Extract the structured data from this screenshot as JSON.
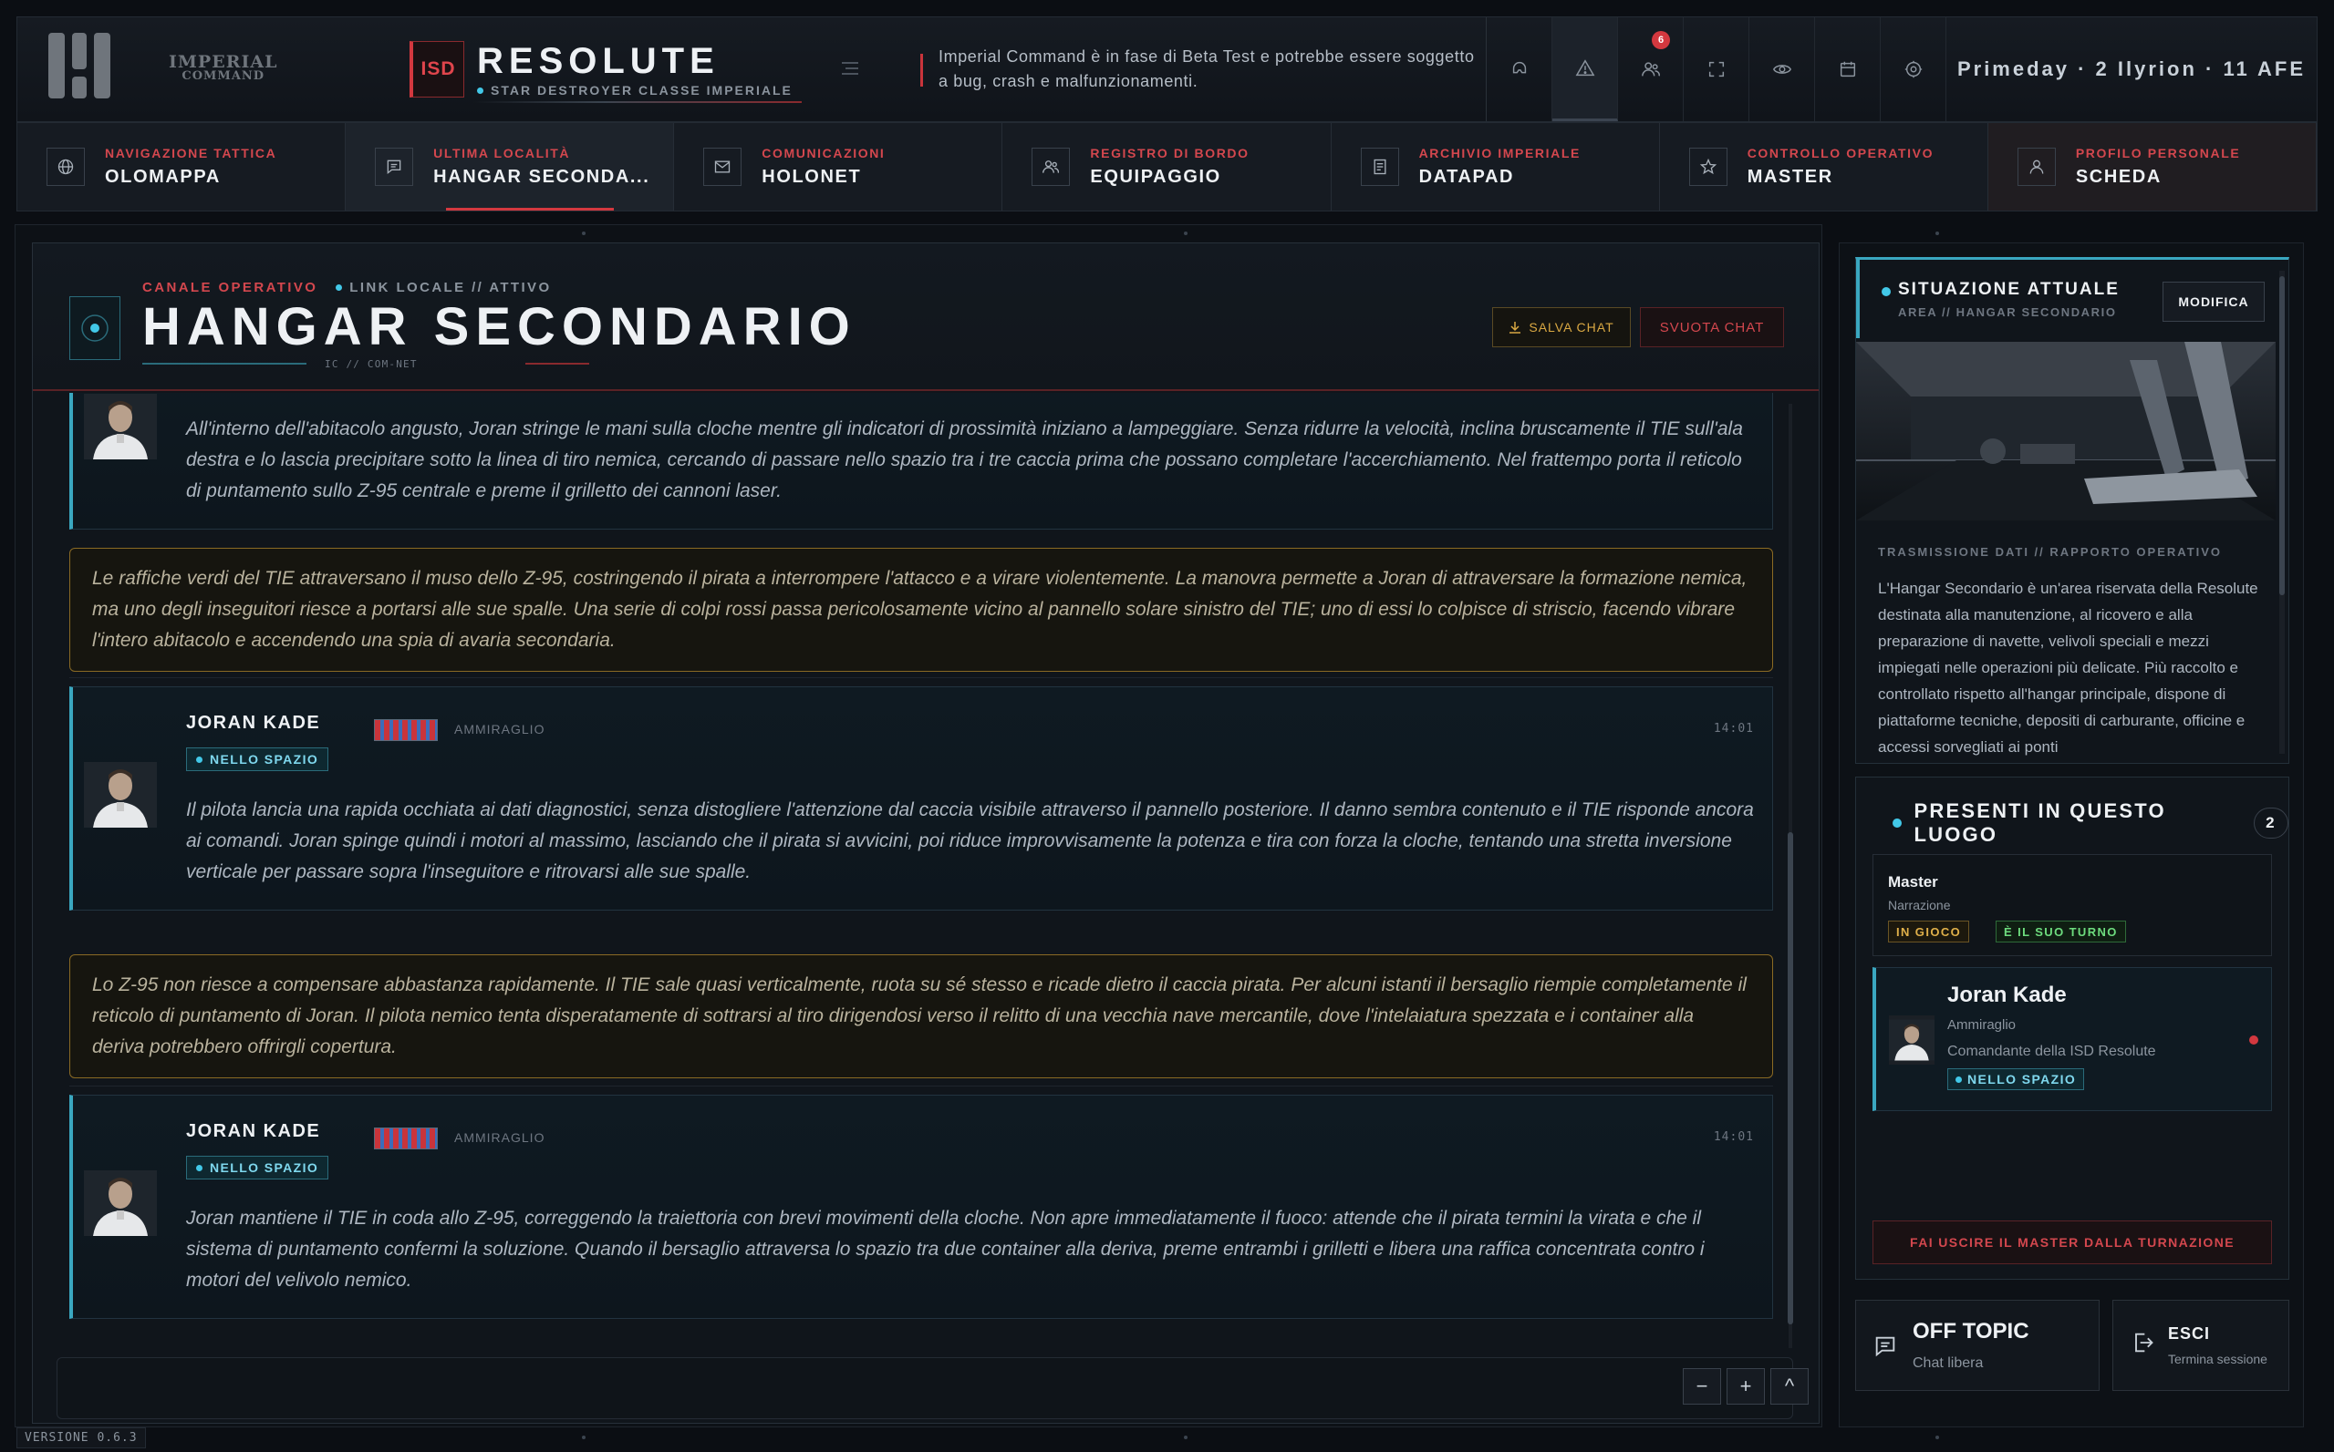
{
  "brand": {
    "logo_line1": "IMPERIAL",
    "logo_line2": "COMMAND"
  },
  "ship": {
    "badge": "ISD",
    "name": "RESOLUTE",
    "class": "STAR DESTROYER CLASSE IMPERIALE"
  },
  "beta_notice": "Imperial Command è in fase di Beta Test e potrebbe essere soggetto a bug, crash e malfunzionamenti.",
  "toolbar": {
    "icons": [
      "helmet-icon",
      "alert-icon",
      "users-icon",
      "fullscreen-icon",
      "eye-icon",
      "calendar-icon",
      "settings-icon"
    ],
    "notification_count": "6"
  },
  "date": "Primeday · 2 Ilyrion · 11 AFE",
  "nav": [
    {
      "small": "NAVIGAZIONE TATTICA",
      "big": "OLOMAPPA"
    },
    {
      "small": "ULTIMA LOCALITÀ",
      "big": "HANGAR SECONDA..."
    },
    {
      "small": "COMUNICAZIONI",
      "big": "HOLONET"
    },
    {
      "small": "REGISTRO DI BORDO",
      "big": "EQUIPAGGIO"
    },
    {
      "small": "ARCHIVIO IMPERIALE",
      "big": "DATAPAD"
    },
    {
      "small": "CONTROLLO OPERATIVO",
      "big": "MASTER"
    },
    {
      "small": "PROFILO PERSONALE",
      "big": "SCHEDA"
    }
  ],
  "chat": {
    "kicker": "CANALE OPERATIVO",
    "link": "LINK LOCALE // ATTIVO",
    "title": "HANGAR SECONDARIO",
    "subtitle": "IC // COM-NET",
    "save_label": "SALVA CHAT",
    "clear_label": "SVUOTA CHAT",
    "messages": [
      {
        "text": "All'interno dell'abitacolo angusto, Joran stringe le mani sulla cloche mentre gli indicatori di prossimità iniziano a lampeggiare. Senza ridurre la velocità, inclina bruscamente il TIE sull'ala destra e lo lascia precipitare sotto la linea di tiro nemica, cercando di passare nello spazio tra i tre caccia prima che possano completare l'accerchiamento. Nel frattempo porta il reticolo di puntamento sullo Z-95 centrale e preme il grilletto dei cannoni laser."
      },
      {
        "narration": "Le raffiche verdi del TIE attraversano il muso dello Z-95, costringendo il pirata a interrompere l'attacco e a virare violentemente. La manovra permette a Joran di attraversare la formazione nemica, ma uno degli inseguitori riesce a portarsi alle sue spalle. Una serie di colpi rossi passa pericolosamente vicino al pannello solare sinistro del TIE; uno di essi lo colpisce di striscio, facendo vibrare l'intero abitacolo e accendendo una spia di avaria secondaria."
      },
      {
        "name": "JORAN KADE",
        "rank": "AMMIRAGLIO",
        "status": "NELLO SPAZIO",
        "time": "14:01",
        "text": "Il pilota lancia una rapida occhiata ai dati diagnostici, senza distogliere l'attenzione dal caccia visibile attraverso il pannello posteriore. Il danno sembra contenuto e il TIE risponde ancora ai comandi. Joran spinge quindi i motori al massimo, lasciando che il pirata si avvicini, poi riduce improvvisamente la potenza e tira con forza la cloche, tentando una stretta inversione verticale per passare sopra l'inseguitore e ritrovarsi alle sue spalle."
      },
      {
        "narration": "Lo Z-95 non riesce a compensare abbastanza rapidamente. Il TIE sale quasi verticalmente, ruota su sé stesso e ricade dietro il caccia pirata. Per alcuni istanti il bersaglio riempie completamente il reticolo di puntamento di Joran. Il pilota nemico tenta disperatamente di sottrarsi al tiro dirigendosi verso il relitto di una vecchia nave mercantile, dove l'intelaiatura spezzata e i container alla deriva potrebbero offrirgli copertura."
      },
      {
        "name": "JORAN KADE",
        "rank": "AMMIRAGLIO",
        "status": "NELLO SPAZIO",
        "time": "14:01",
        "text": "Joran mantiene il TIE in coda allo Z-95, correggendo la traiettoria con brevi movimenti della cloche. Non apre immediatamente il fuoco: attende che il pirata termini la virata e che il sistema di puntamento confermi la soluzione. Quando il bersaglio attraversa lo spazio tra due container alla deriva, preme entrambi i grilletti e libera una raffica concentrata contro i motori del velivolo nemico."
      }
    ],
    "zoom_out": "−",
    "zoom_in": "+",
    "scroll_top": "^"
  },
  "version": "VERSIONE 0.6.3",
  "situation": {
    "title": "SITUAZIONE ATTUALE",
    "subtitle": "AREA // HANGAR SECONDARIO",
    "edit_label": "MODIFICA",
    "report_label": "TRASMISSIONE DATI // RAPPORTO OPERATIVO",
    "report_text": "L'Hangar Secondario è un'area riservata della Resolute destinata alla manutenzione, al ricovero e alla preparazione di navette, velivoli speciali e mezzi impiegati nelle operazioni più delicate. Più raccolto e controllato rispetto all'hangar principale, dispone di piattaforme tecniche, depositi di carburante, officine e accessi sorvegliati ai ponti"
  },
  "present": {
    "title": "PRESENTI IN QUESTO LUOGO",
    "count": "2",
    "master": {
      "name": "Master",
      "role": "Narrazione",
      "tag1": "IN GIOCO",
      "tag2": "È IL SUO TURNO"
    },
    "joran": {
      "name": "Joran Kade",
      "rank": "Ammiraglio",
      "desc": "Comandante della ISD Resolute",
      "status": "NELLO SPAZIO"
    },
    "exit_master_label": "FAI USCIRE IL MASTER DALLA TURNAZIONE"
  },
  "offtopic": {
    "title": "OFF TOPIC",
    "sub": "Chat libera"
  },
  "logout": {
    "title": "ESCI",
    "sub": "Termina sessione"
  },
  "colors": {
    "accent_red": "#d3383f",
    "accent_cyan": "#3aa7c0",
    "narration_gold": "#8a6a24",
    "background": "#0b0e13"
  }
}
